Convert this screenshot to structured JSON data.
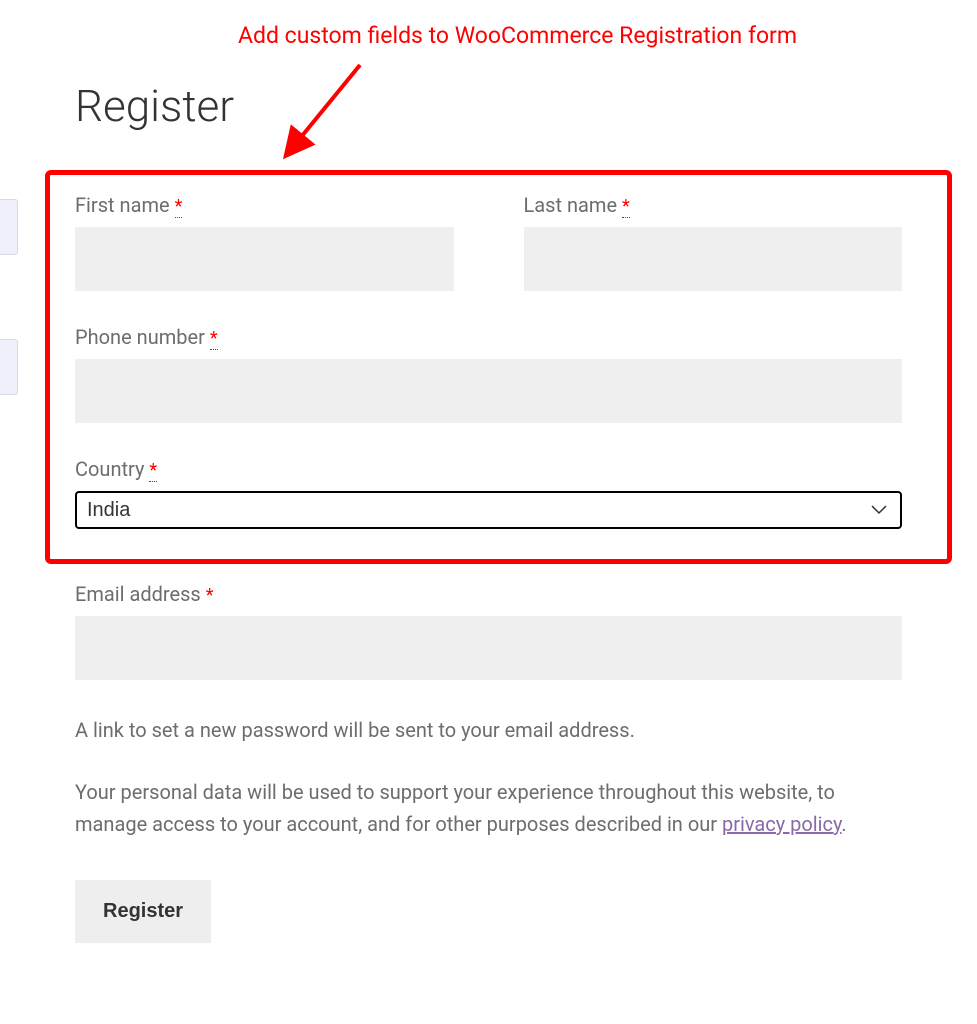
{
  "annotation": {
    "text": "Add custom fields to WooCommerce Registration form"
  },
  "page": {
    "title": "Register"
  },
  "form": {
    "first_name": {
      "label": "First name",
      "required_mark": "*",
      "value": ""
    },
    "last_name": {
      "label": "Last name",
      "required_mark": "*",
      "value": ""
    },
    "phone": {
      "label": "Phone number",
      "required_mark": "*",
      "value": ""
    },
    "country": {
      "label": "Country",
      "required_mark": "*",
      "selected": "India"
    },
    "email": {
      "label": "Email address",
      "required_mark": "*",
      "value": ""
    },
    "password_hint": "A link to set a new password will be sent to your email address.",
    "privacy_text_before": "Your personal data will be used to support your experience throughout this website, to manage access to your account, and for other purposes described in our ",
    "privacy_link_text": "privacy policy",
    "privacy_text_after": ".",
    "submit_label": "Register"
  }
}
